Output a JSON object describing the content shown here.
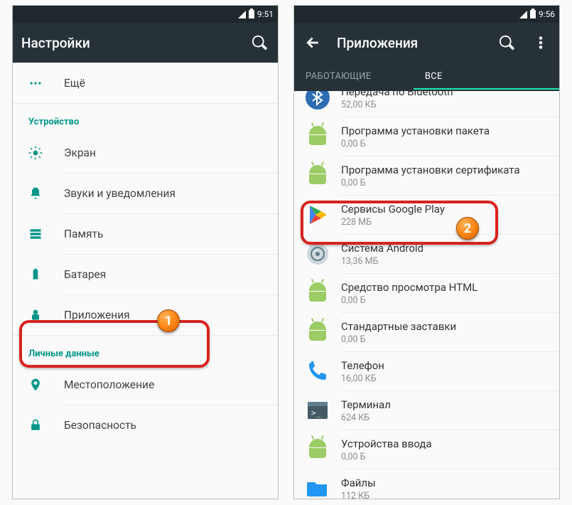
{
  "left": {
    "status_time": "9:51",
    "title": "Настройки",
    "more_label": "Ещё",
    "section_device": "Устройство",
    "device_items": [
      {
        "label": "Экран",
        "icon": "display-icon"
      },
      {
        "label": "Звуки и уведомления",
        "icon": "bell-icon"
      },
      {
        "label": "Память",
        "icon": "storage-icon"
      },
      {
        "label": "Батарея",
        "icon": "battery-icon"
      },
      {
        "label": "Приложения",
        "icon": "apps-icon"
      }
    ],
    "section_personal": "Личные данные",
    "personal_items": [
      {
        "label": "Местоположение",
        "icon": "location-icon"
      },
      {
        "label": "Безопасность",
        "icon": "lock-icon"
      }
    ]
  },
  "right": {
    "status_time": "9:56",
    "title": "Приложения",
    "tabs": {
      "running": "РАБОТАЮЩИЕ",
      "all": "ВСЕ"
    },
    "apps": [
      {
        "name": "Передача по Bluetooth",
        "size": "52,00 КБ",
        "icon": "bluetooth"
      },
      {
        "name": "Программа установки пакета",
        "size": "0,00 Б",
        "icon": "droid"
      },
      {
        "name": "Программа установки сертификата",
        "size": "0,00 Б",
        "icon": "droid"
      },
      {
        "name": "Сервисы Google Play",
        "size": "228 МБ",
        "icon": "play"
      },
      {
        "name": "Система Android",
        "size": "13,36 МБ",
        "icon": "system"
      },
      {
        "name": "Средство просмотра HTML",
        "size": "0,00 Б",
        "icon": "droid"
      },
      {
        "name": "Стандартные заставки",
        "size": "0,00 Б",
        "icon": "droid"
      },
      {
        "name": "Телефон",
        "size": "16,00 КБ",
        "icon": "phone"
      },
      {
        "name": "Терминал",
        "size": "624 КБ",
        "icon": "terminal"
      },
      {
        "name": "Устройства ввода",
        "size": "0,00 Б",
        "icon": "droid"
      },
      {
        "name": "Файлы",
        "size": "112 КБ",
        "icon": "folder"
      }
    ]
  },
  "callouts": {
    "one": "1",
    "two": "2"
  }
}
